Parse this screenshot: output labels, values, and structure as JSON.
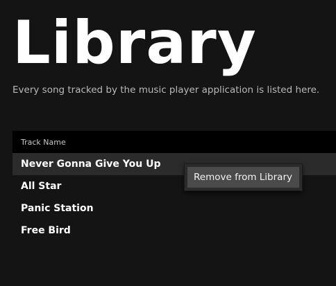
{
  "page": {
    "title": "Library",
    "subtitle": "Every song tracked by the music player application is listed here."
  },
  "table": {
    "column_header": "Track Name",
    "rows": [
      {
        "track_name": "Never Gonna Give You Up",
        "selected": true
      },
      {
        "track_name": "All Star",
        "selected": false
      },
      {
        "track_name": "Panic Station",
        "selected": false
      },
      {
        "track_name": "Free Bird",
        "selected": false
      }
    ]
  },
  "context_menu": {
    "items": [
      {
        "label": "Remove from Library"
      }
    ]
  },
  "colors": {
    "background": "#141414",
    "header_background": "#000000",
    "selected_row": "#2b2b2b",
    "menu_item_highlight": "#4a4a4a"
  }
}
